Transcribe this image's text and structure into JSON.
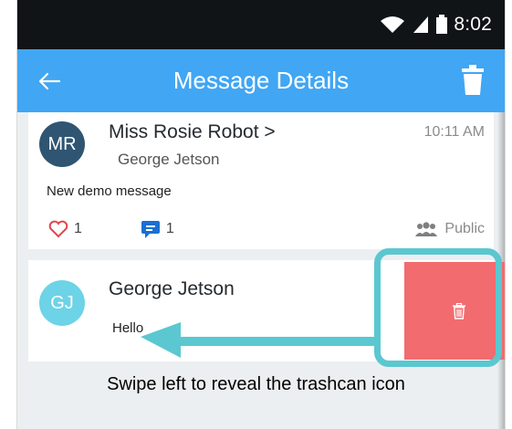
{
  "status_bar": {
    "time": "8:02"
  },
  "header": {
    "title": "Message Details"
  },
  "messages": [
    {
      "avatar_initials": "MR",
      "sender": "Miss Rosie Robot >",
      "recipient": "George Jetson",
      "time": "10:11 AM",
      "body": "New demo message",
      "likes": "1",
      "comments": "1",
      "visibility": "Public"
    },
    {
      "avatar_initials": "GJ",
      "sender": "George Jetson",
      "body": "Hello"
    }
  ],
  "caption": "Swipe left to reveal the trashcan icon",
  "colors": {
    "header_blue": "#41a6f3",
    "delete_red": "#f26b6e",
    "highlight_teal": "#5bc7d0",
    "avatar_mr": "#2f5572",
    "avatar_gj": "#6dd3e6"
  }
}
